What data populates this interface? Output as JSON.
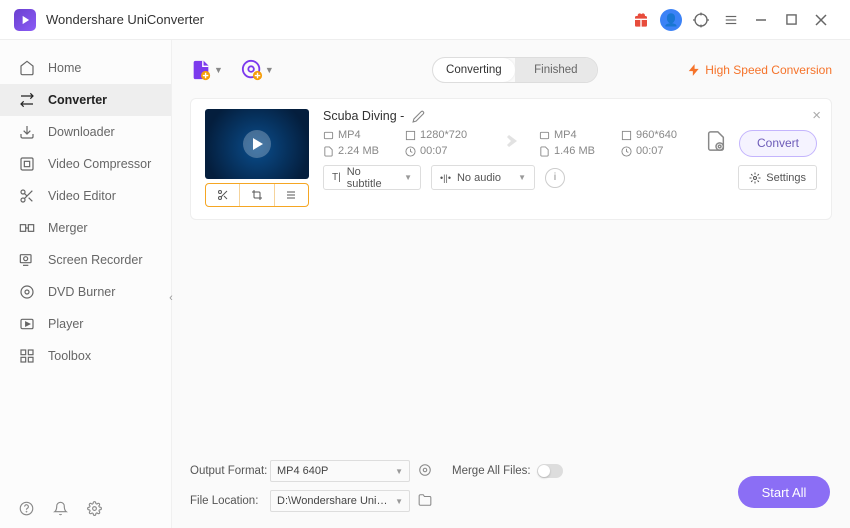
{
  "app": {
    "name": "Wondershare UniConverter"
  },
  "sidebar": {
    "items": [
      {
        "label": "Home"
      },
      {
        "label": "Converter"
      },
      {
        "label": "Downloader"
      },
      {
        "label": "Video Compressor"
      },
      {
        "label": "Video Editor"
      },
      {
        "label": "Merger"
      },
      {
        "label": "Screen Recorder"
      },
      {
        "label": "DVD Burner"
      },
      {
        "label": "Player"
      },
      {
        "label": "Toolbox"
      }
    ]
  },
  "tabs": {
    "converting": "Converting",
    "finished": "Finished"
  },
  "high_speed": "High Speed Conversion",
  "file": {
    "name": "Scuba Diving -",
    "src": {
      "format": "MP4",
      "resolution": "1280*720",
      "size": "2.24 MB",
      "duration": "00:07"
    },
    "dst": {
      "format": "MP4",
      "resolution": "960*640",
      "size": "1.46 MB",
      "duration": "00:07"
    },
    "subtitle": "No subtitle",
    "audio": "No audio",
    "settings_label": "Settings",
    "convert_label": "Convert"
  },
  "bottom": {
    "output_format_label": "Output Format:",
    "output_format_value": "MP4 640P",
    "file_location_label": "File Location:",
    "file_location_value": "D:\\Wondershare UniConverter",
    "merge_label": "Merge All Files:",
    "start_all": "Start All"
  }
}
